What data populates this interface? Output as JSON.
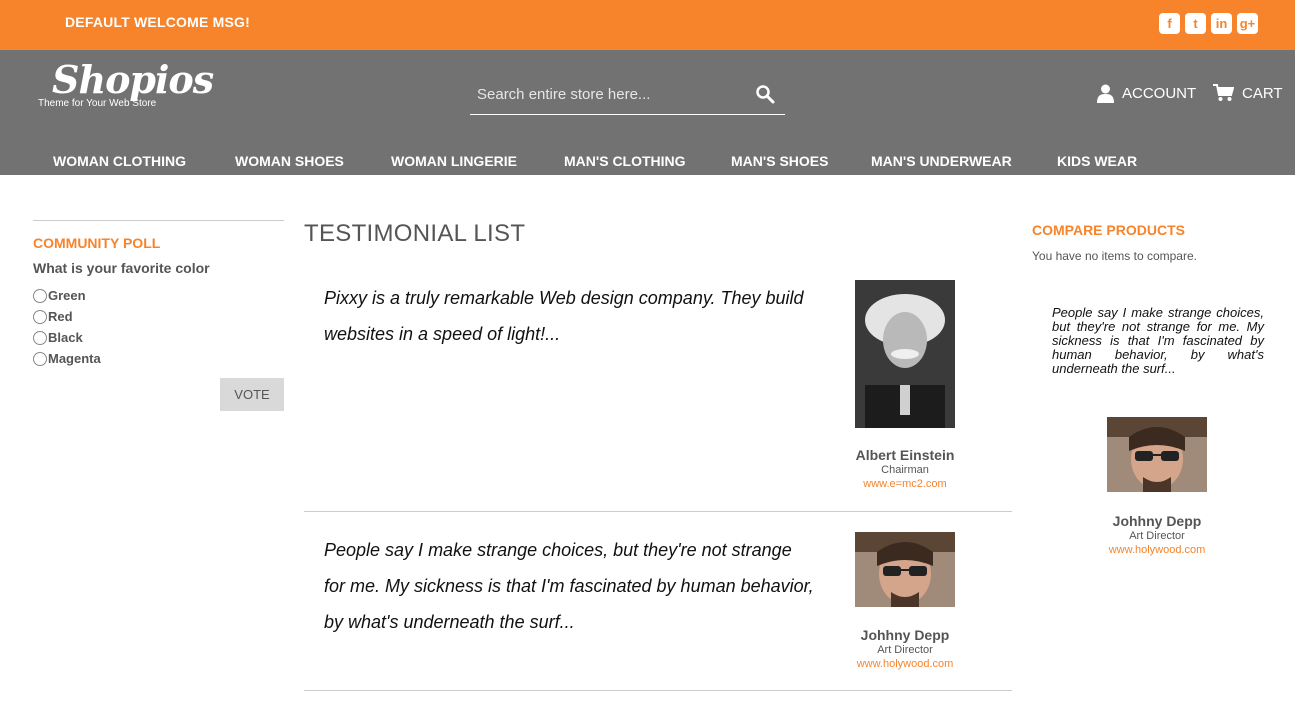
{
  "topbar": {
    "welcome": "DEFAULT WELCOME MSG!",
    "socials": [
      {
        "label": "f",
        "icon": "facebook-icon"
      },
      {
        "label": "t",
        "icon": "twitter-icon"
      },
      {
        "label": "in",
        "icon": "linkedin-icon"
      },
      {
        "label": "g+",
        "icon": "google-plus-icon"
      }
    ]
  },
  "header": {
    "logo": {
      "main": "Shopios",
      "tagline": "Theme for Your Web Store"
    },
    "search": {
      "placeholder": "Search entire store here..."
    },
    "account_label": "ACCOUNT",
    "cart_label": "CART"
  },
  "nav": [
    "WOMAN CLOTHING",
    "WOMAN SHOES",
    "WOMAN LINGERIE",
    "MAN'S CLOTHING",
    "MAN'S SHOES",
    "MAN'S UNDERWEAR",
    "KIDS WEAR"
  ],
  "poll": {
    "title": "COMMUNITY POLL",
    "question": "What is your favorite color",
    "options": [
      "Green",
      "Red",
      "Black",
      "Magenta"
    ],
    "vote_label": "VOTE"
  },
  "main": {
    "title": "TESTIMONIAL LIST",
    "testimonials": [
      {
        "quote": "Pixxy is a truly remarkable Web design company. They build websites in a speed of light!...",
        "name": "Albert Einstein",
        "role": "Chairman",
        "link": "www.e=mc2.com"
      },
      {
        "quote": "People say I make strange choices, but they're not strange for me. My sickness is that I'm fascinated by human behavior, by what's underneath the surf...",
        "name": "Johhny Depp",
        "role": "Art Director",
        "link": "www.holywood.com"
      }
    ]
  },
  "compare": {
    "title": "COMPARE PRODUCTS",
    "empty_text": "You have no items to compare."
  },
  "side_testimonial": {
    "quote": "People say I make strange choices, but they're not strange for me. My sickness is that I'm fascinated by human behavior, by what's underneath the surf...",
    "name": "Johhny Depp",
    "role": "Art Director",
    "link": "www.holywood.com"
  },
  "colors": {
    "accent": "#f7842b",
    "header_bg": "#727272"
  }
}
